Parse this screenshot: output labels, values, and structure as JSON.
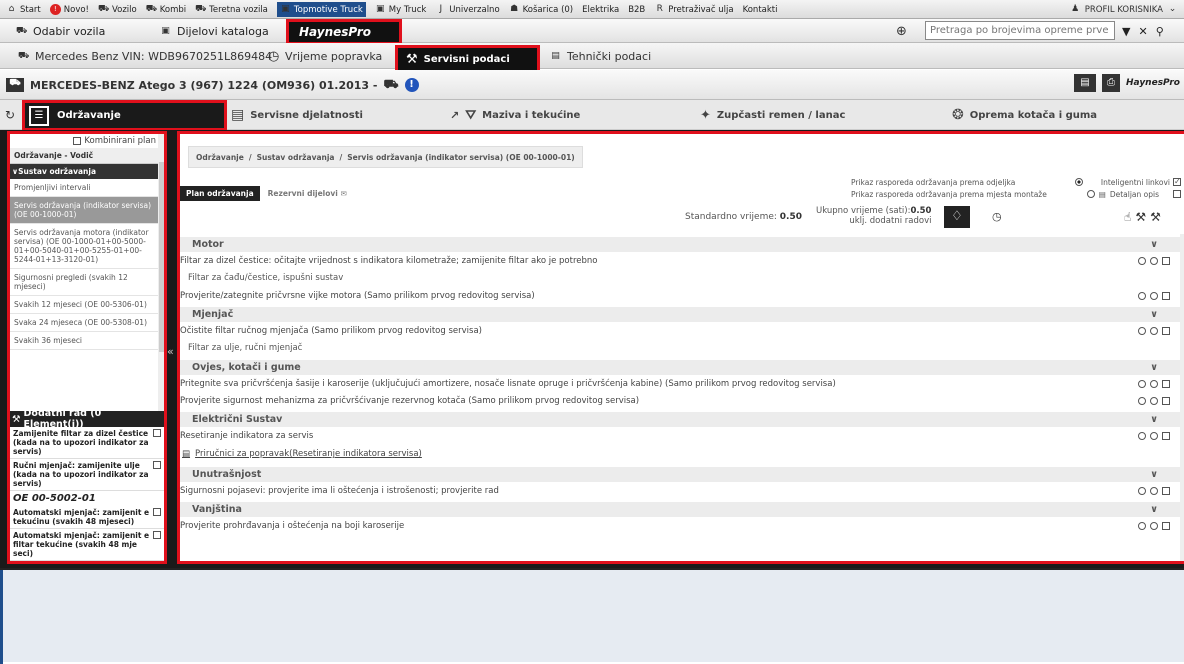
{
  "topbar": {
    "items": [
      {
        "label": "Start",
        "icon": "home-icon"
      },
      {
        "label": "Novo!",
        "icon": "new-icon"
      },
      {
        "label": "Vozilo",
        "icon": "car-icon"
      },
      {
        "label": "Kombi",
        "icon": "van-icon"
      },
      {
        "label": "Teretna vozila",
        "icon": "truck-icon"
      },
      {
        "label": "Topmotive Truck",
        "icon": "topmotive-icon"
      },
      {
        "label": "My Truck",
        "icon": "my-truck-icon"
      },
      {
        "label": "Univerzalno",
        "icon": "universal-icon"
      },
      {
        "label": "Košarica (0)",
        "icon": "cart-icon"
      },
      {
        "label": "Elektrika",
        "icon": ""
      },
      {
        "label": "B2B",
        "icon": ""
      },
      {
        "label": "Pretraživač ulja",
        "icon": "oil-search-icon"
      },
      {
        "label": "Kontakti",
        "icon": ""
      }
    ],
    "profile": "PROFIL KORISNIKA"
  },
  "bar2": {
    "vehicle_select": "Odabir vozila",
    "parts_catalog": "Dijelovi kataloga",
    "haynes": "HaynesPro",
    "search_placeholder": "Pretraga po brojevima opreme prve ugr"
  },
  "bar3": {
    "vin": "Mercedes Benz VIN: WDB9670251L869484",
    "repair_time": "Vrijeme popravka",
    "service_data": "Servisni podaci",
    "tech_data": "Tehnički podaci"
  },
  "vehicle": {
    "title": "MERCEDES-BENZ Atego 3 (967) 1224 (OM936) 01.2013 -"
  },
  "tabs": {
    "maintenance": "Održavanje",
    "service_activities": "Servisne djelatnosti",
    "lubricants": "Maziva i tekućine",
    "timing": "Zupčasti remen / lanac",
    "wheels": "Oprema kotača i guma"
  },
  "left": {
    "combined_plan": "Kombinirani plan",
    "guide": "Održavanje - Vodič",
    "system": "Sustav održavanja",
    "items": [
      "Promjenljivi intervali",
      "Servis održavanja (indikator servisa) (OE 00-1000-01)",
      "Servis održavanja motora (indikator servisa) (OE 00-1000-01+00-5000-01+00-5040-01+00-5255-01+00-5244-01+13-3120-01)",
      "Sigurnosni pregledi (svakih 12 mjeseci)",
      "Svakih 12 mjeseci (OE 00-5306-01)",
      "Svaka 24 mjeseca (OE 00-5308-01)",
      "Svakih 36 mjeseci"
    ],
    "extra_work_title": "Dodatni rad (0 Element(i))",
    "extra_items": [
      "Zamijenite filtar za dizel čestice (kada na to upozori indikator za servis)",
      "Ručni mjenjač: zamijenite ulje (kada na to upozori indikator za servis)",
      "OE 00-5002-01",
      "Automatski mjenjač: zamijenit e tekućinu (svakih 48 mjeseci)",
      "Automatski mjenjač: zamijenit e filtar tekućine (svakih 48 mje seci)"
    ]
  },
  "main": {
    "breadcrumb": [
      "Održavanje",
      "Sustav održavanja",
      "Servis održavanja (indikator servisa) (OE 00-1000-01)"
    ],
    "subtabs": [
      "Plan održavanja",
      "Rezervni dijelovi"
    ],
    "options": {
      "by_dept": "Prikaz rasporeda održavanja prema odjeljka",
      "by_location": "Prikaz rasporeda održavanja prema mjesta montaže",
      "smart_links": "Inteligentni linkovi",
      "detailed": "Detaljan opis"
    },
    "standard_time_label": "Standardno vrijeme:",
    "standard_time": "0.50",
    "total_time_label": "Ukupno vrijeme (sati):",
    "total_time": "0.50",
    "incl_extra": "uklj. dodatni radovi",
    "sections": [
      {
        "name": "Motor",
        "rows": [
          {
            "type": "op",
            "text": "Filtar za dizel čestice: očitajte vrijednost s indikatora kilometraže; zamijenite filtar ako je potrebno"
          },
          {
            "type": "sub",
            "text": "Filtar za čađu/čestice, ispušni sustav"
          },
          {
            "type": "op",
            "text": "Provjerite/zategnite pričvrsne vijke motora (Samo prilikom prvog redovitog servisa)"
          }
        ]
      },
      {
        "name": "Mjenjač",
        "rows": [
          {
            "type": "op",
            "text": "Očistite filtar ručnog mjenjača (Samo prilikom prvog redovitog servisa)"
          },
          {
            "type": "sub",
            "text": "Filtar za ulje, ručni mjenjač"
          }
        ]
      },
      {
        "name": "Ovjes, kotači i gume",
        "rows": [
          {
            "type": "op",
            "text": "Pritegnite sva pričvršćenja šasije i karoserije (uključujući amortizere, nosače lisnate opruge i pričvršćenja kabine) (Samo prilikom prvog redovitog servisa)"
          },
          {
            "type": "op",
            "text": "Provjerite sigurnost mehanizma za pričvršćivanje rezervnog kotača (Samo prilikom prvog redovitog servisa)"
          }
        ]
      },
      {
        "name": "Električni Sustav",
        "rows": [
          {
            "type": "op",
            "text": "Resetiranje indikatora za servis"
          },
          {
            "type": "link",
            "text": "Priručnici za popravak(Resetiranje indikatora servisa)"
          }
        ]
      },
      {
        "name": "Unutrašnjost",
        "rows": [
          {
            "type": "op",
            "text": "Sigurnosni pojasevi: provjerite ima li oštećenja i istrošenosti; provjerite rad"
          }
        ]
      },
      {
        "name": "Vanjština",
        "rows": [
          {
            "type": "op",
            "text": "Provjerite prohrđavanja i oštećenja na boji karoserije"
          }
        ]
      }
    ]
  }
}
